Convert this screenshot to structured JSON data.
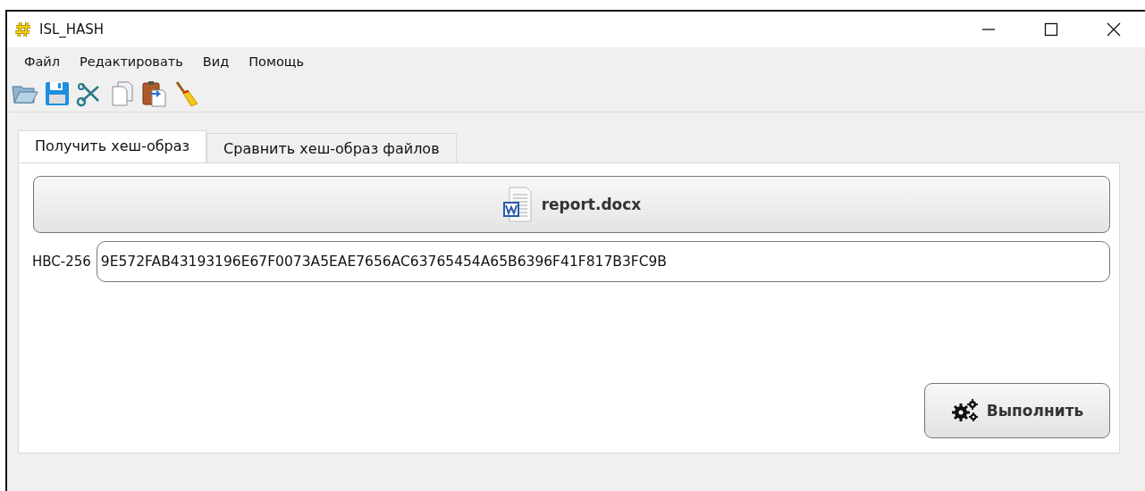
{
  "window": {
    "title": "ISL_HASH"
  },
  "menu": [
    "Файл",
    "Редактировать",
    "Вид",
    "Помощь"
  ],
  "toolbar": [
    {
      "kind": "open"
    },
    {
      "kind": "save"
    },
    {
      "kind": "cut"
    },
    {
      "kind": "copy"
    },
    {
      "kind": "paste"
    },
    {
      "kind": "clear"
    }
  ],
  "tabs": [
    {
      "label": "Получить хеш-образ",
      "selected": true
    },
    {
      "label": "Сравнить хеш-образ файлов",
      "selected": false
    }
  ],
  "file_button": {
    "label": "report.docx"
  },
  "hash": {
    "label": "HBC-256",
    "value": "9E572FAB43193196E67F0073A5EAE7656AC63765454A65B6396F41F817B3FC9B"
  },
  "run_button": {
    "label": "Выполнить"
  }
}
